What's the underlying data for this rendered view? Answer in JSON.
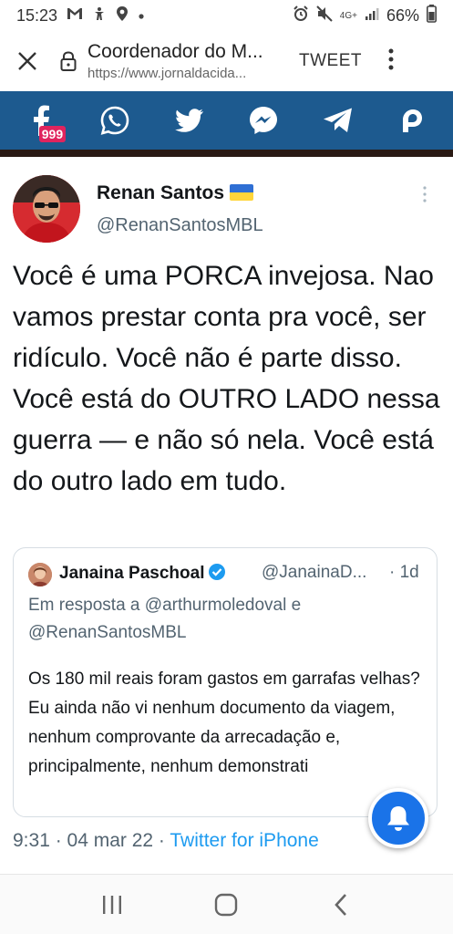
{
  "status_bar": {
    "time": "15:23",
    "network": "4G+",
    "battery": "66%",
    "icons": [
      "gmail-icon",
      "accessibility-icon",
      "location-icon",
      "dot-icon",
      "alarm-icon",
      "mute-icon",
      "signal-icon",
      "battery-icon"
    ]
  },
  "browser": {
    "title": "Coordenador do M...",
    "url": "https://www.jornaldacida...",
    "tweet_label": "TWEET",
    "icons": [
      "close-icon",
      "lock-icon",
      "more-vertical-icon"
    ]
  },
  "share_bar": {
    "color": "#1d5a8f",
    "facebook_count": "999",
    "items": [
      "facebook-icon",
      "whatsapp-icon",
      "twitter-icon",
      "messenger-icon",
      "telegram-icon",
      "parler-icon"
    ]
  },
  "tweet": {
    "author_name": "Renan Santos",
    "author_handle": "@RenanSantosMBL",
    "text": "Você é uma PORCA invejosa. Nao vamos prestar conta pra você, ser ridículo. Você não é parte disso. Você está do OUTRO LADO nessa guerra — e não só nela. Você está do outro lado em tudo.",
    "quote": {
      "name": "Janaina Paschoal",
      "handle": "@JanainaD...",
      "time": "· 1d",
      "reply_line": "Em resposta a @arthurmoledoval e @RenanSantosMBL",
      "text": "Os 180 mil reais foram gastos em garrafas velhas? Eu ainda não vi nenhum documento da viagem, nenhum comprovante da arrecadação e, principalmente, nenhum demonstrati"
    },
    "time": "9:31 · 04 mar 22 · ",
    "source": "Twitter for iPhone",
    "link_color": "#1d9bf0"
  },
  "nav": {
    "items": [
      "recent-apps-icon",
      "home-icon",
      "back-icon"
    ]
  }
}
